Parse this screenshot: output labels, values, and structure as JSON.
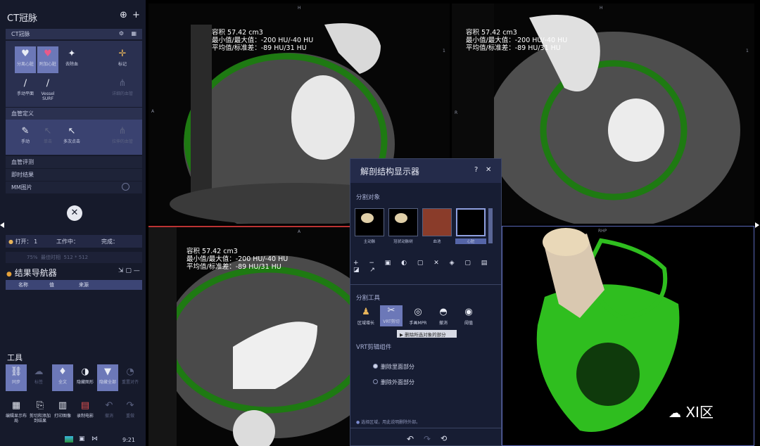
{
  "left": {
    "title": "CT冠脉",
    "subtitle": "CT冠脉",
    "tools": [
      "分离心脏",
      "附加心脏",
      "去除血",
      "标记",
      "手动平面",
      "Vessel SURF",
      "详细的血管"
    ],
    "section_vessel": "血管定义",
    "vessel_tools": [
      "手动",
      "单击",
      "多次点击",
      "拉伸的血管"
    ],
    "section_eval": "血管评测",
    "section_results": "即时结果",
    "section_mm": "MM图片",
    "status": {
      "open": "打开：",
      "open_n": "1",
      "working": "工作中：",
      "done": "完成："
    },
    "sub": {
      "pct": "75%",
      "text": "最佳时相",
      "matrix": "512 * 512"
    },
    "nav_title": "结果导航器",
    "nav_cols": [
      "名称",
      "值",
      "来源"
    ],
    "tools_title": "工具",
    "bottom_tools": [
      "同步",
      "标签",
      "全文",
      "隐藏图形",
      "隐藏全部",
      "重置对齐"
    ],
    "bottom_tools2": [
      "编辑显示布局",
      "剪切和添加到结果",
      "打印图像",
      "录制电影",
      "撤消",
      "重做"
    ],
    "clock": "9:21"
  },
  "viewports": {
    "stats": {
      "vol": "容积 57.42 cm3",
      "minmax": "最小值/最大值：-200 HU/-40 HU",
      "mean": "平均值/标准差：-89 HU/31 HU"
    },
    "stats2": {
      "vol": "容积 57.42 cm3",
      "minmax": "最小值/最大值：-200 HU/-40 HU",
      "mean": "平均值/标准差：-89 HU/31 HU"
    },
    "labels": {
      "h": "H",
      "a": "A",
      "r": "R",
      "rhp": "RHP",
      "one": "1"
    }
  },
  "dialog": {
    "title": "解剖结构显示器",
    "help": "?",
    "close": "✕",
    "seg_label": "分割对象",
    "thumbs": [
      "主动脉",
      "冠状动脉树",
      "血池",
      "心脏"
    ],
    "tools_label": "分割工具",
    "seg_tools": [
      "区域增长",
      "VRT剪切",
      "手画MPR",
      "撤消",
      "阈值"
    ],
    "tooltip": "删除所选对象的部分",
    "vrt_label": "VRT剪辑组件",
    "opt1": "删除里面部分",
    "opt2": "删除外面部分",
    "hint": "选择区域，用此说明删除外部。"
  },
  "watermark": "XI区"
}
